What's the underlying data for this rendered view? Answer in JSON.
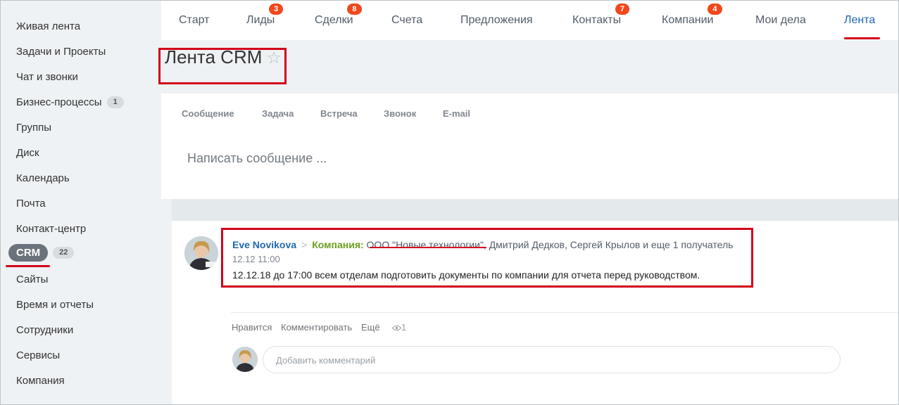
{
  "sidebar": {
    "items": [
      {
        "label": "Живая лента"
      },
      {
        "label": "Задачи и Проекты"
      },
      {
        "label": "Чат и звонки"
      },
      {
        "label": "Бизнес-процессы",
        "badge": "1"
      },
      {
        "label": "Группы"
      },
      {
        "label": "Диск"
      },
      {
        "label": "Календарь"
      },
      {
        "label": "Почта"
      },
      {
        "label": "Контакт-центр"
      },
      {
        "label": "CRM",
        "badge": "22"
      },
      {
        "label": "Сайты"
      },
      {
        "label": "Время и отчеты"
      },
      {
        "label": "Сотрудники"
      },
      {
        "label": "Сервисы"
      },
      {
        "label": "Компания"
      }
    ]
  },
  "topnav": {
    "items": [
      {
        "label": "Старт"
      },
      {
        "label": "Лиды",
        "badge": "3"
      },
      {
        "label": "Сделки",
        "badge": "8"
      },
      {
        "label": "Счета"
      },
      {
        "label": "Предложения"
      },
      {
        "label": "Контакты",
        "badge": "7"
      },
      {
        "label": "Компании",
        "badge": "4"
      },
      {
        "label": "Мои дела"
      },
      {
        "label": "Лента"
      }
    ]
  },
  "page": {
    "title": "Лента CRM",
    "star": "☆"
  },
  "composer": {
    "tabs": [
      "Сообщение",
      "Задача",
      "Встреча",
      "Звонок",
      "E-mail"
    ],
    "placeholder": "Написать сообщение ..."
  },
  "post": {
    "author": "Eve Novikova",
    "arrow": ">",
    "dest_label": "Компания:",
    "company": "ООО \"Новые технологии\"",
    "recipients": ", Дмитрий Дедков, Сергей Крылов  и еще 1 получатель",
    "time": "12.12 11:00",
    "text": "12.12.18 до 17:00 всем отделам подготовить документы по компании для отчета перед руководством.",
    "actions": {
      "like": "Нравится",
      "comment": "Комментировать",
      "more": "Ещё",
      "views": "1"
    },
    "comment_placeholder": "Добавить комментарий"
  },
  "colors": {
    "accent": "#2067b0",
    "highlight": "#d2001c",
    "badge": "#f0481c",
    "destination": "#6b9f1e"
  }
}
